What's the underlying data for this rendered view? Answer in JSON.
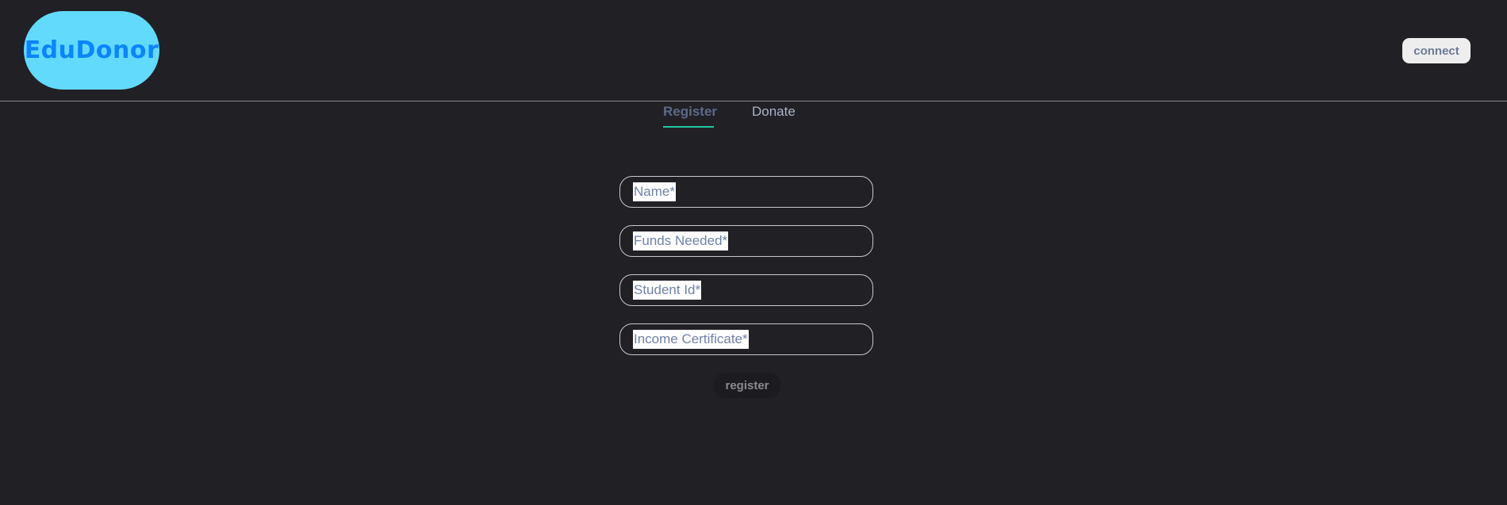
{
  "header": {
    "logo_text": "EduDonor",
    "connect_label": "connect"
  },
  "tabs": [
    {
      "label": "Register",
      "active": true
    },
    {
      "label": "Donate",
      "active": false
    }
  ],
  "form": {
    "fields": [
      {
        "label": "Name*"
      },
      {
        "label": "Funds Needed*"
      },
      {
        "label": "Student Id*"
      },
      {
        "label": "Income Certificate*"
      }
    ],
    "submit_label": "register"
  },
  "colors": {
    "background": "#212025",
    "logo_bg": "#61dafb",
    "logo_text": "#0a84ff",
    "tab_underline": "#22c9a0"
  }
}
